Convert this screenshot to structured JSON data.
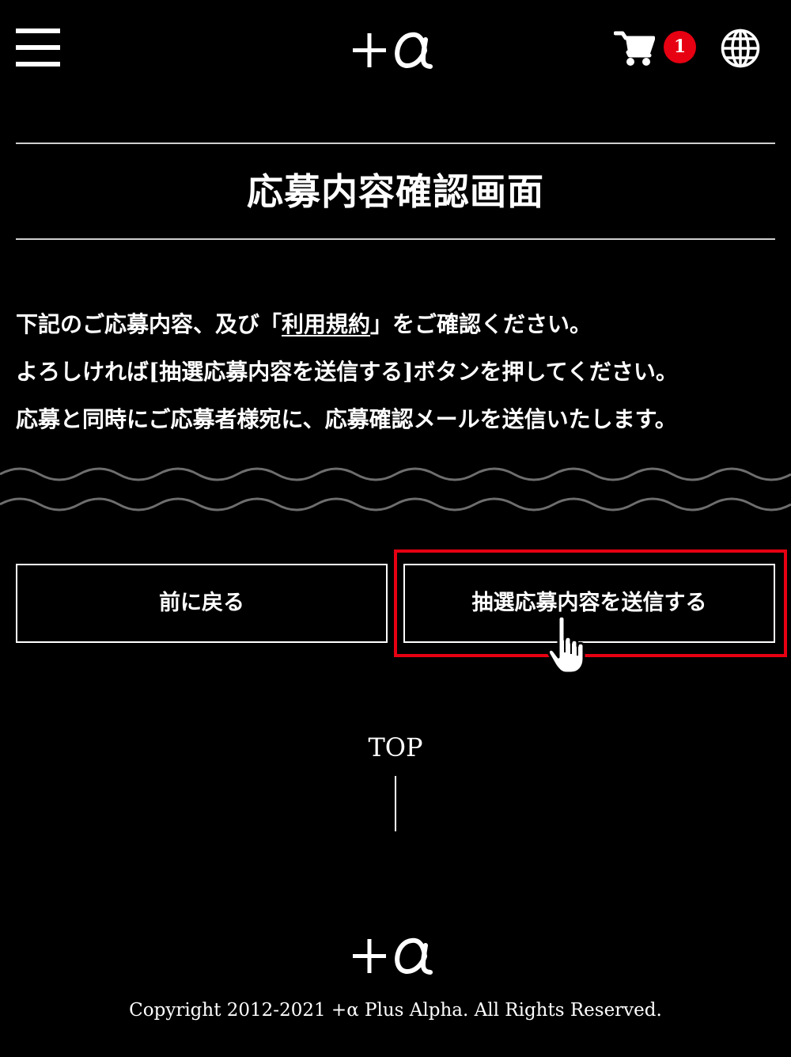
{
  "header": {
    "menu_icon": "hamburger-menu-icon",
    "logo_alt": "+α logo",
    "cart_icon": "cart-icon",
    "cart_count": "1",
    "language_icon": "globe-icon"
  },
  "page": {
    "title": "応募内容確認画面"
  },
  "notice": {
    "line1_before": "下記のご応募内容、及び「",
    "terms_link": "利用規約",
    "line1_after": "」をご確認ください。",
    "line2": "よろしければ[抽選応募内容を送信する]ボタンを押してください。",
    "line3": "応募と同時にご応募者様宛に、応募確認メールを送信いたします。"
  },
  "actions": {
    "back_label": "前に戻る",
    "submit_label": "抽選応募内容を送信する"
  },
  "footer": {
    "top_label": "TOP",
    "copyright": "Copyright 2012-2021 +α Plus Alpha. All Rights Reserved."
  },
  "colors": {
    "background": "#000000",
    "text": "#ffffff",
    "badge": "#e60012",
    "highlight": "#e60012",
    "wave": "#6e6e6e"
  }
}
